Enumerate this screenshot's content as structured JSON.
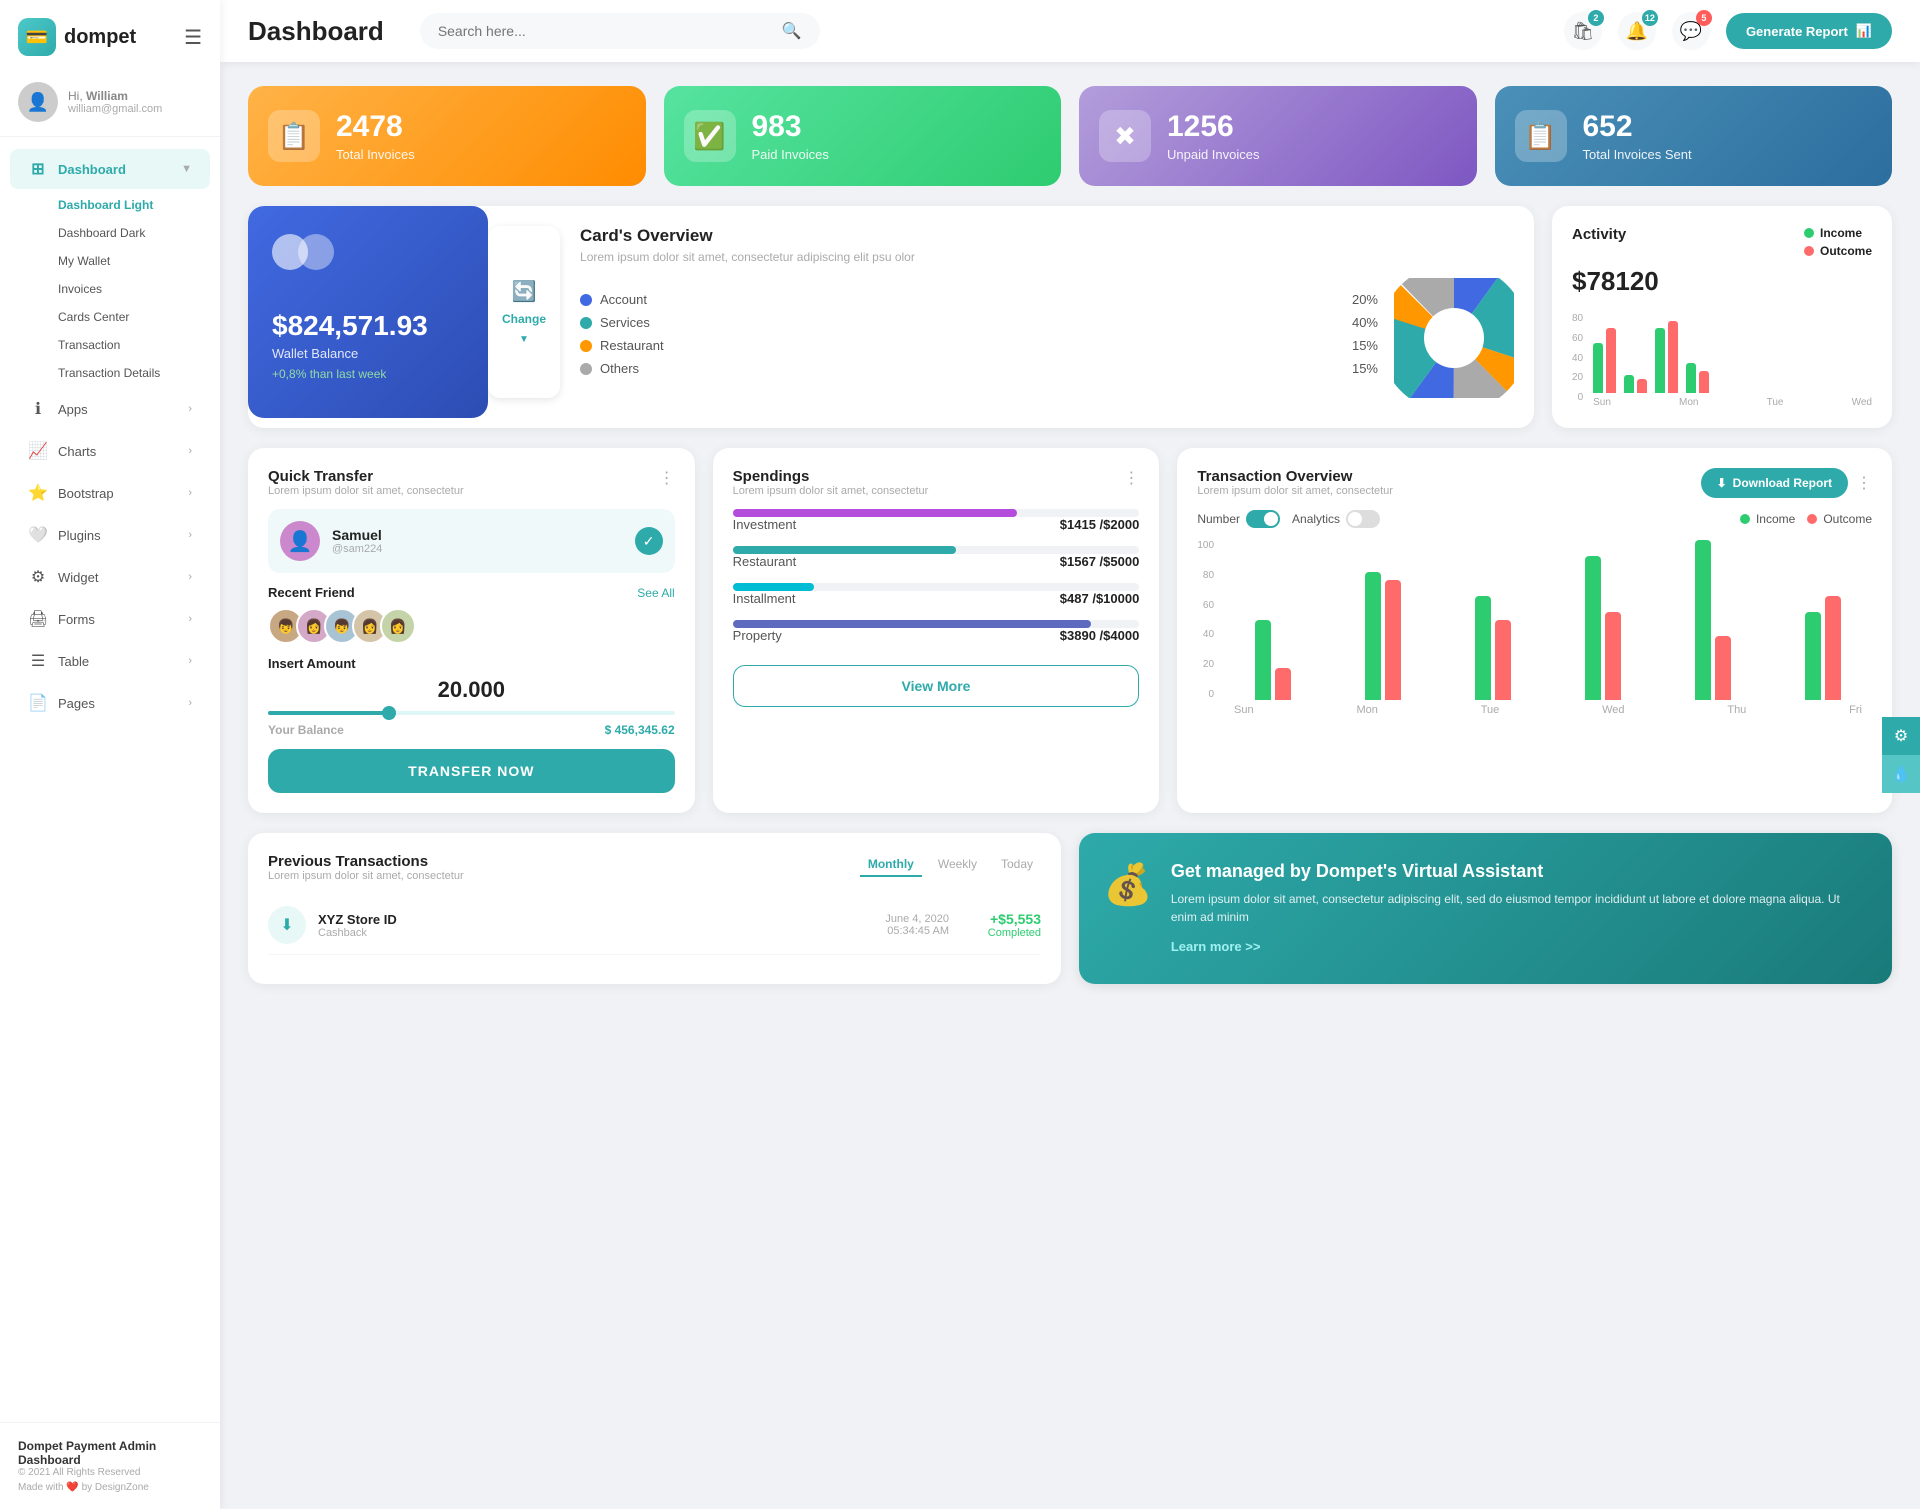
{
  "app": {
    "name": "dompet",
    "logo_char": "💰"
  },
  "header": {
    "title": "Dashboard",
    "search_placeholder": "Search here...",
    "generate_btn": "Generate Report",
    "icons": [
      {
        "name": "bell-icon",
        "badge": "2",
        "char": "🔔"
      },
      {
        "name": "notification-icon",
        "badge": "12",
        "char": "🔔"
      },
      {
        "name": "message-icon",
        "badge": "5",
        "char": "💬"
      }
    ]
  },
  "user": {
    "greeting": "Hi,",
    "name": "William",
    "email": "william@gmail.com"
  },
  "sidebar": {
    "main_items": [
      {
        "label": "Dashboard",
        "icon": "⊞",
        "active": true,
        "arrow": true
      },
      {
        "label": "Apps",
        "icon": "ℹ",
        "arrow": true
      },
      {
        "label": "Charts",
        "icon": "📈",
        "arrow": true
      },
      {
        "label": "Bootstrap",
        "icon": "⭐",
        "arrow": true
      },
      {
        "label": "Plugins",
        "icon": "🤍",
        "arrow": true
      },
      {
        "label": "Widget",
        "icon": "⚙",
        "arrow": true
      },
      {
        "label": "Forms",
        "icon": "🖨",
        "arrow": true
      },
      {
        "label": "Table",
        "icon": "☰",
        "arrow": true
      },
      {
        "label": "Pages",
        "icon": "📄",
        "arrow": true
      }
    ],
    "sub_items": [
      {
        "label": "Dashboard Light",
        "active": true
      },
      {
        "label": "Dashboard Dark",
        "active": false
      },
      {
        "label": "My Wallet",
        "active": false
      },
      {
        "label": "Invoices",
        "active": false
      },
      {
        "label": "Cards Center",
        "active": false
      },
      {
        "label": "Transaction",
        "active": false
      },
      {
        "label": "Transaction Details",
        "active": false
      }
    ],
    "footer": {
      "brand": "Dompet Payment Admin Dashboard",
      "copy": "© 2021 All Rights Reserved",
      "made": "Made with ❤️ by DesignZone"
    }
  },
  "stats": [
    {
      "number": "2478",
      "label": "Total Invoices",
      "icon": "📋",
      "color": "orange"
    },
    {
      "number": "983",
      "label": "Paid Invoices",
      "icon": "✅",
      "color": "green"
    },
    {
      "number": "1256",
      "label": "Unpaid Invoices",
      "icon": "✖",
      "color": "purple"
    },
    {
      "number": "652",
      "label": "Total Invoices Sent",
      "icon": "📋",
      "color": "blue"
    }
  ],
  "wallet": {
    "balance": "$824,571.93",
    "label": "Wallet Balance",
    "change": "+0,8% than last week",
    "change_btn": "Change"
  },
  "cards_overview": {
    "title": "Card's Overview",
    "desc": "Lorem ipsum dolor sit amet, consectetur adipiscing elit psu olor",
    "items": [
      {
        "label": "Account",
        "pct": "20%",
        "color": "#4169e1"
      },
      {
        "label": "Services",
        "pct": "40%",
        "color": "#2eaaaa"
      },
      {
        "label": "Restaurant",
        "pct": "15%",
        "color": "#ff9800"
      },
      {
        "label": "Others",
        "pct": "15%",
        "color": "#aaa"
      }
    ]
  },
  "activity": {
    "title": "Activity",
    "amount": "$78120",
    "legend": [
      {
        "label": "Income",
        "color": "#2ecc71"
      },
      {
        "label": "Outcome",
        "color": "#ff6b6b"
      }
    ],
    "bars": [
      {
        "green": 50,
        "red": 65,
        "label": "Sun"
      },
      {
        "green": 20,
        "red": 15,
        "label": "Mon"
      },
      {
        "green": 65,
        "red": 70,
        "label": "Tue"
      },
      {
        "green": 30,
        "red": 25,
        "label": "Wed"
      }
    ],
    "y_labels": [
      "80",
      "60",
      "40",
      "20",
      "0"
    ]
  },
  "quick_transfer": {
    "title": "Quick Transfer",
    "desc": "Lorem ipsum dolor sit amet, consectetur",
    "user": {
      "name": "Samuel",
      "handle": "@sam224",
      "avatar_char": "👤"
    },
    "recent_friends_label": "Recent Friend",
    "see_all": "See All",
    "friends": [
      "👦",
      "👩",
      "👦",
      "👩",
      "👩"
    ],
    "amount_label": "Insert Amount",
    "amount_value": "20.000",
    "balance_label": "Your Balance",
    "balance_value": "$ 456,345.62",
    "transfer_btn": "TRANSFER NOW"
  },
  "spendings": {
    "title": "Spendings",
    "desc": "Lorem ipsum dolor sit amet, consectetur",
    "items": [
      {
        "label": "Investment",
        "value": "$1415",
        "total": "$2000",
        "pct": 70,
        "color": "#b44ddb"
      },
      {
        "label": "Restaurant",
        "value": "$1567",
        "total": "$5000",
        "pct": 55,
        "color": "#2eaaaa"
      },
      {
        "label": "Installment",
        "value": "$487",
        "total": "$10000",
        "pct": 20,
        "color": "#00bcd4"
      },
      {
        "label": "Property",
        "value": "$3890",
        "total": "$4000",
        "pct": 88,
        "color": "#5c6bc0"
      }
    ],
    "view_more_btn": "View More"
  },
  "transaction_overview": {
    "title": "Transaction Overview",
    "desc": "Lorem ipsum dolor sit amet, consectetur",
    "toggle1_label": "Number",
    "toggle2_label": "Analytics",
    "download_btn": "Download Report",
    "legend": [
      {
        "label": "Income",
        "color": "#2ecc71"
      },
      {
        "label": "Outcome",
        "color": "#ff6b6b"
      }
    ],
    "bars": [
      {
        "green": 50,
        "red": 20,
        "label": "Sun"
      },
      {
        "green": 80,
        "red": 75,
        "label": "Mon"
      },
      {
        "green": 65,
        "red": 50,
        "label": "Tue"
      },
      {
        "green": 90,
        "red": 55,
        "label": "Wed"
      },
      {
        "green": 100,
        "red": 40,
        "label": "Thu"
      },
      {
        "green": 55,
        "red": 65,
        "label": "Fri"
      }
    ],
    "y_labels": [
      "100",
      "80",
      "60",
      "40",
      "20",
      "0"
    ]
  },
  "prev_transactions": {
    "title": "Previous Transactions",
    "desc": "Lorem ipsum dolor sit amet, consectetur",
    "tabs": [
      "Monthly",
      "Weekly",
      "Today"
    ],
    "active_tab": "Monthly",
    "items": [
      {
        "name": "XYZ Store ID",
        "sub": "Cashback",
        "date": "June 4, 2020",
        "time": "05:34:45 AM",
        "amount": "+$5,553",
        "status": "Completed",
        "icon": "⬇",
        "icon_color": "#2eaaaa"
      }
    ]
  },
  "virtual_assistant": {
    "title": "Get managed by Dompet's Virtual Assistant",
    "desc": "Lorem ipsum dolor sit amet, consectetur adipiscing elit, sed do eiusmod tempor incididunt ut labore et dolore magna aliqua. Ut enim ad minim",
    "link": "Learn more >>",
    "icon": "💰"
  },
  "right_float": [
    {
      "icon": "⚙",
      "name": "settings-icon"
    },
    {
      "icon": "💧",
      "name": "theme-icon"
    }
  ]
}
